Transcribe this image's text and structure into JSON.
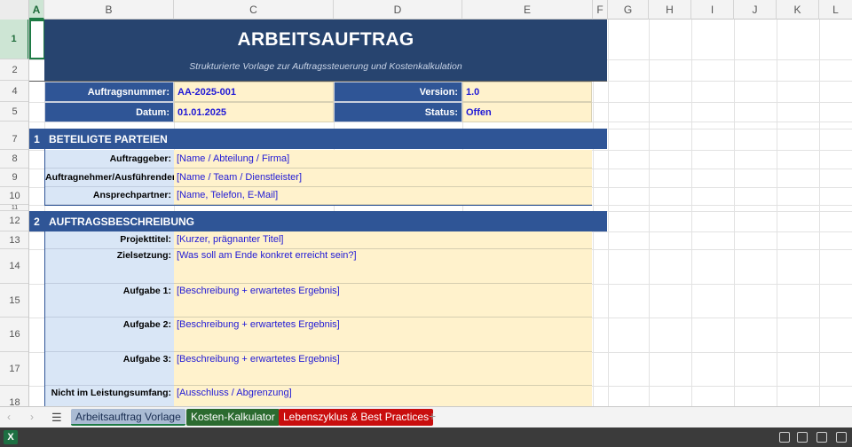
{
  "columns": [
    "A",
    "B",
    "C",
    "D",
    "E",
    "F",
    "G",
    "H",
    "I",
    "J",
    "K",
    "L"
  ],
  "rows": [
    "1",
    "2",
    "4",
    "5",
    "7",
    "8",
    "9",
    "10",
    "11",
    "12",
    "13",
    "14",
    "15",
    "16",
    "17",
    "18"
  ],
  "header": {
    "title": "ARBEITSAUFTRAG",
    "subtitle": "Strukturierte Vorlage zur Auftragssteuerung und Kostenkalkulation"
  },
  "meta": {
    "auftragsnummer_label": "Auftragsnummer:",
    "auftragsnummer_value": "AA-2025-001",
    "version_label": "Version:",
    "version_value": "1.0",
    "datum_label": "Datum:",
    "datum_value": "01.01.2025",
    "status_label": "Status:",
    "status_value": "Offen"
  },
  "section1": {
    "number": "1",
    "title": "BETEILIGTE PARTEIEN",
    "rows": [
      {
        "label": "Auftraggeber:",
        "value": "[Name / Abteilung / Firma]"
      },
      {
        "label": "Auftragnehmer/Ausführender:",
        "value": "[Name / Team / Dienstleister]"
      },
      {
        "label": "Ansprechpartner:",
        "value": "[Name, Telefon, E-Mail]"
      }
    ]
  },
  "section2": {
    "number": "2",
    "title": "AUFTRAGSBESCHREIBUNG",
    "rows": [
      {
        "label": "Projekttitel:",
        "value": "[Kurzer, prägnanter Titel]"
      },
      {
        "label": "Zielsetzung:",
        "value": "[Was soll am Ende konkret erreicht sein?]"
      },
      {
        "label": "Aufgabe 1:",
        "value": "[Beschreibung + erwartetes Ergebnis]"
      },
      {
        "label": "Aufgabe 2:",
        "value": "[Beschreibung + erwartetes Ergebnis]"
      },
      {
        "label": "Aufgabe 3:",
        "value": "[Beschreibung + erwartetes Ergebnis]"
      },
      {
        "label": "Nicht im Leistungsumfang:",
        "value": "[Ausschluss / Abgrenzung]"
      }
    ]
  },
  "tabs": [
    {
      "label": "Arbeitsauftrag Vorlage",
      "active": true
    },
    {
      "label": "Kosten-Kalkulator"
    },
    {
      "label": "Lebenszyklus & Best Practices"
    }
  ],
  "colors": {
    "title_band": "#27446f",
    "section_bar": "#2f5596",
    "label_light": "#d9e6f6",
    "value_cream": "#fff2cc",
    "value_text": "#2019d6",
    "tab_green": "#2c6b30",
    "tab_red": "#c90e0e"
  }
}
